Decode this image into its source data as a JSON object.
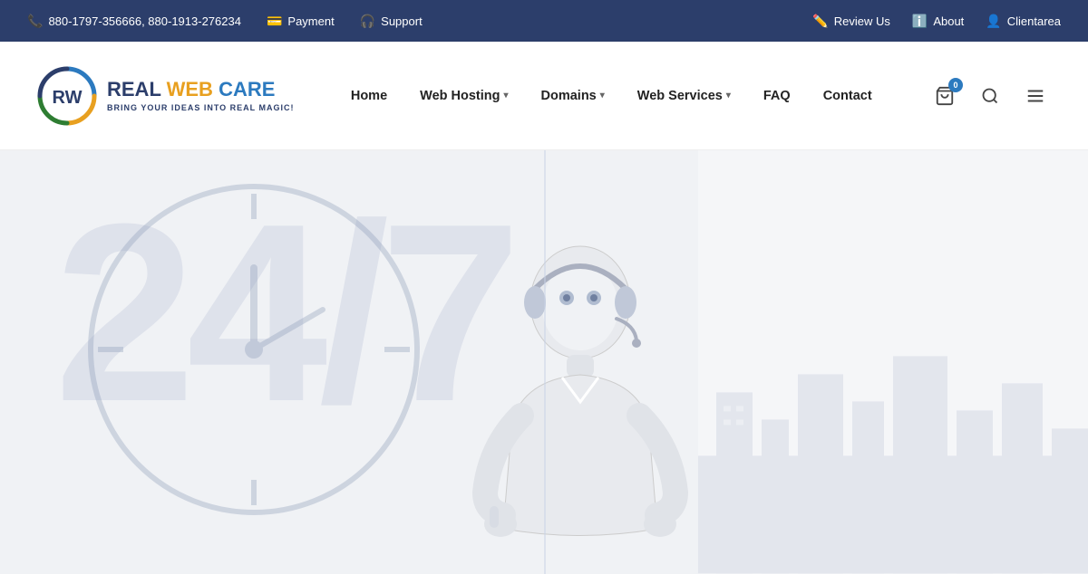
{
  "topbar": {
    "phone": "880-1797-356666, 880-1913-276234",
    "payment_label": "Payment",
    "support_label": "Support",
    "review_label": "Review Us",
    "about_label": "About",
    "clientarea_label": "Clientarea"
  },
  "header": {
    "logo_rw": "REAL ",
    "logo_web": "WEB ",
    "logo_care": "CARE",
    "logo_subtitle": "BRING YOUR IDEAS INTO REAL MAGIC!",
    "cart_count": "0"
  },
  "nav": {
    "home": "Home",
    "web_hosting": "Web Hosting",
    "domains": "Domains",
    "web_services": "Web Services",
    "faq": "FAQ",
    "contact": "Contact"
  },
  "hero": {
    "bg_number": "24/7"
  }
}
